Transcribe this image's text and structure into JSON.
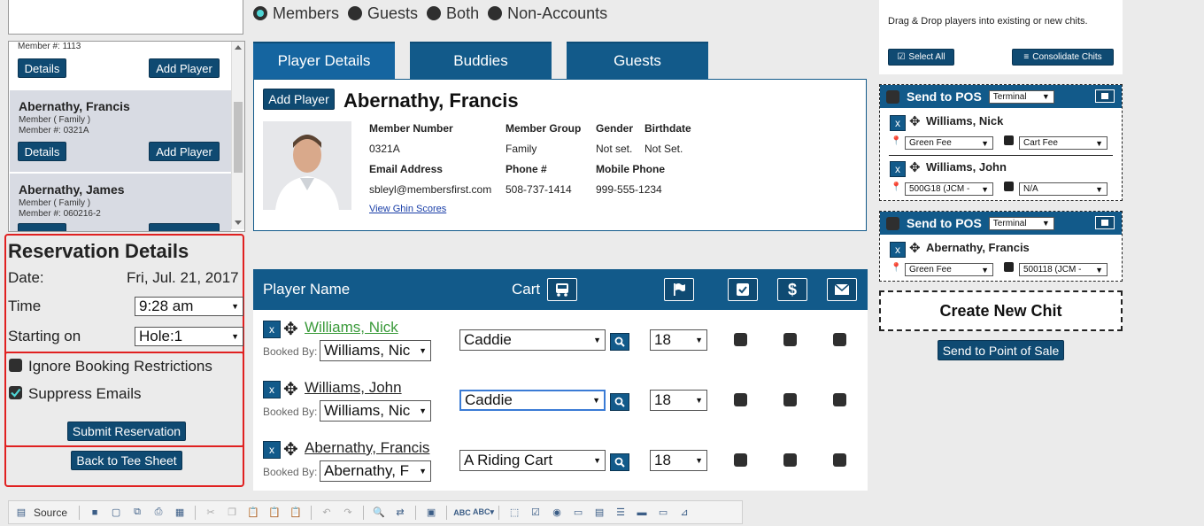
{
  "filters": {
    "options": [
      "Members",
      "Guests",
      "Both",
      "Non-Accounts"
    ],
    "selected": "Members"
  },
  "member_list": {
    "partial_member_line": "Member #: 1113",
    "details_label": "Details",
    "add_player_label": "Add Player",
    "items": [
      {
        "name": "Abernathy, Francis",
        "type": "Member ( Family )",
        "member_no": "Member #: 0321A"
      },
      {
        "name": "Abernathy, James",
        "type": "Member ( Family )",
        "member_no": "Member #: 060216-2"
      }
    ]
  },
  "reservation": {
    "title": "Reservation Details",
    "date_label": "Date:",
    "date_value": "Fri, Jul. 21, 2017",
    "time_label": "Time",
    "time_value": "9:28 am",
    "starting_label": "Starting on",
    "starting_value": "Hole:1",
    "ignore_label": "Ignore Booking Restrictions",
    "ignore_checked": false,
    "suppress_label": "Suppress Emails",
    "suppress_checked": true,
    "submit_label": "Submit Reservation",
    "back_label": "Back to Tee Sheet"
  },
  "tabs": [
    "Player Details",
    "Buddies",
    "Guests"
  ],
  "player_details": {
    "add_player": "Add Player",
    "name": "Abernathy, Francis",
    "fields": {
      "member_number_label": "Member Number",
      "member_number": "0321A",
      "member_group_label": "Member Group",
      "member_group": "Family",
      "gender_label": "Gender",
      "gender": "Not set.",
      "birthdate_label": "Birthdate",
      "birthdate": "Not Set.",
      "email_label": "Email Address",
      "email": "sbleyl@membersfirst.com",
      "phone_label": "Phone #",
      "phone": "508-737-1414",
      "mobile_label": "Mobile Phone",
      "mobile": "999-555-1234"
    },
    "ghin_link": "View Ghin Scores"
  },
  "player_table": {
    "col_player": "Player Name",
    "col_cart": "Cart",
    "booked_by_label": "Booked By:",
    "rows": [
      {
        "name": "Williams, Nick",
        "booked_by": "Williams, Nic",
        "cart": "Caddie",
        "holes": "18",
        "linkcolor": "#3a9a3a"
      },
      {
        "name": "Williams, John",
        "booked_by": "Williams, Nic",
        "cart": "Caddie",
        "holes": "18",
        "linkcolor": "#222222"
      },
      {
        "name": "Abernathy, Francis",
        "booked_by": "Abernathy, F",
        "cart": "A Riding Cart",
        "holes": "18",
        "linkcolor": "#222222"
      }
    ]
  },
  "chits_panel": {
    "instructions": "Drag & Drop players into existing or new chits.",
    "select_all": "Select All",
    "consolidate": "Consolidate Chits",
    "send_to_pos": "Send to POS",
    "terminal": "Terminal",
    "chits": [
      {
        "players": [
          {
            "name": "Williams, Nick",
            "fee": "Green Fee",
            "cart_fee": "Cart Fee"
          },
          {
            "name": "Williams, John",
            "fee": "500G18 (JCM -",
            "cart_fee": "N/A"
          }
        ]
      },
      {
        "players": [
          {
            "name": "Abernathy, Francis",
            "fee": "Green Fee",
            "cart_fee": "500118 (JCM -"
          }
        ]
      }
    ],
    "create_new_chit": "Create New Chit",
    "send_point_of_sale": "Send to Point of Sale"
  },
  "editor_toolbar": {
    "source_label": "Source"
  },
  "colors": {
    "navy": "#125a8a",
    "red_border": "#e02020"
  }
}
